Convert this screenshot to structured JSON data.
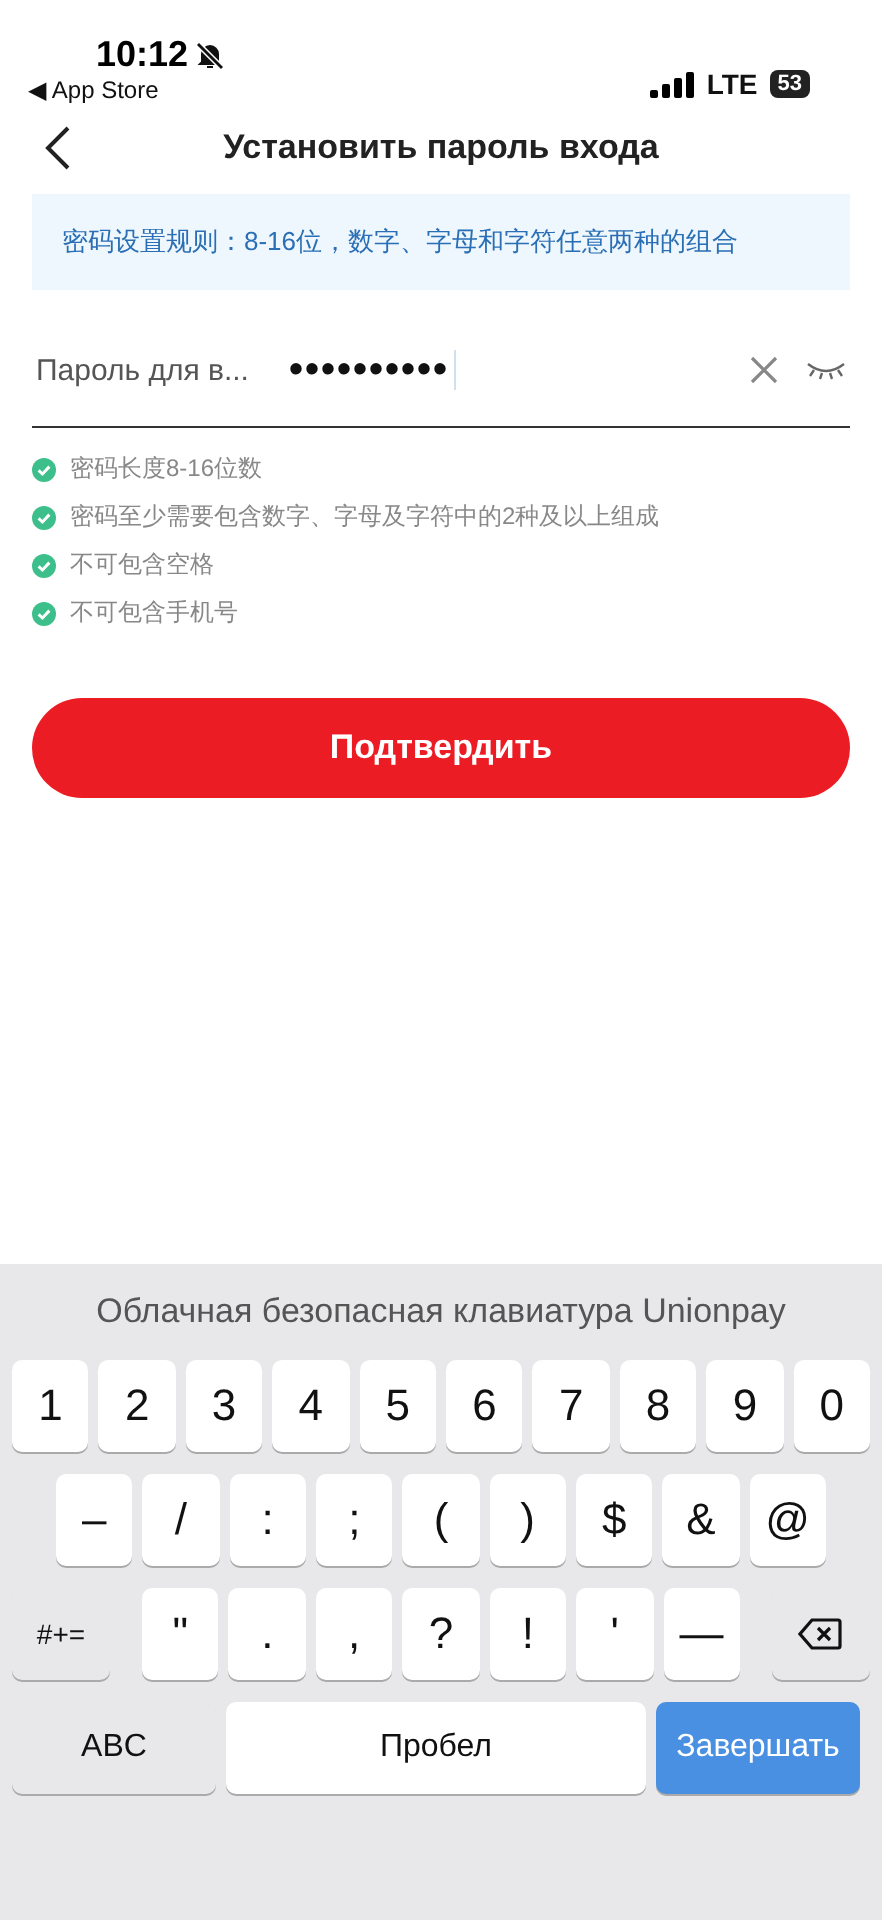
{
  "status_bar": {
    "time": "10:12",
    "back_app": "◀ App Store",
    "network": "LTE",
    "battery": "53",
    "silent": true
  },
  "nav": {
    "title": "Установить пароль входа"
  },
  "banner": "密码设置规则：8-16位，数字、字母和字符任意两种的组合",
  "password_field": {
    "label": "Пароль для в...",
    "value": "••••••••••",
    "clear_button": true,
    "hidden": true
  },
  "rules": [
    {
      "text": "密码长度8-16位数",
      "met": true
    },
    {
      "text": "密码至少需要包含数字、字母及字符中的2种及以上组成",
      "met": true
    },
    {
      "text": "不可包含空格",
      "met": true
    },
    {
      "text": "不可包含手机号",
      "met": true
    }
  ],
  "confirm_button": "Подтвердить",
  "keyboard": {
    "title": "Облачная безопасная клавиатура Unionpay",
    "rows": [
      {
        "keys": [
          {
            "kind": "char",
            "label": "1"
          },
          {
            "kind": "char",
            "label": "2"
          },
          {
            "kind": "char",
            "label": "3"
          },
          {
            "kind": "char",
            "label": "4"
          },
          {
            "kind": "char",
            "label": "5"
          },
          {
            "kind": "char",
            "label": "6"
          },
          {
            "kind": "char",
            "label": "7"
          },
          {
            "kind": "char",
            "label": "8"
          },
          {
            "kind": "char",
            "label": "9"
          },
          {
            "kind": "char",
            "label": "0"
          }
        ]
      },
      {
        "keys": [
          {
            "kind": "char",
            "label": "–"
          },
          {
            "kind": "char",
            "label": "/"
          },
          {
            "kind": "char",
            "label": ":"
          },
          {
            "kind": "char",
            "label": ";"
          },
          {
            "kind": "char",
            "label": "("
          },
          {
            "kind": "char",
            "label": ")"
          },
          {
            "kind": "char",
            "label": "$"
          },
          {
            "kind": "char",
            "label": "&"
          },
          {
            "kind": "char",
            "label": "@"
          }
        ]
      },
      {
        "keys": [
          {
            "kind": "mode",
            "label": "#+="
          },
          {
            "kind": "char",
            "label": "\""
          },
          {
            "kind": "char",
            "label": "."
          },
          {
            "kind": "char",
            "label": ","
          },
          {
            "kind": "char",
            "label": "?"
          },
          {
            "kind": "char",
            "label": "!"
          },
          {
            "kind": "char",
            "label": "'"
          },
          {
            "kind": "char",
            "label": "—"
          },
          {
            "kind": "delete"
          }
        ]
      },
      {
        "keys": [
          {
            "kind": "abc",
            "label": "ABC"
          },
          {
            "kind": "space",
            "label": "Пробел"
          },
          {
            "kind": "done",
            "label": "Завершать"
          }
        ]
      }
    ]
  }
}
